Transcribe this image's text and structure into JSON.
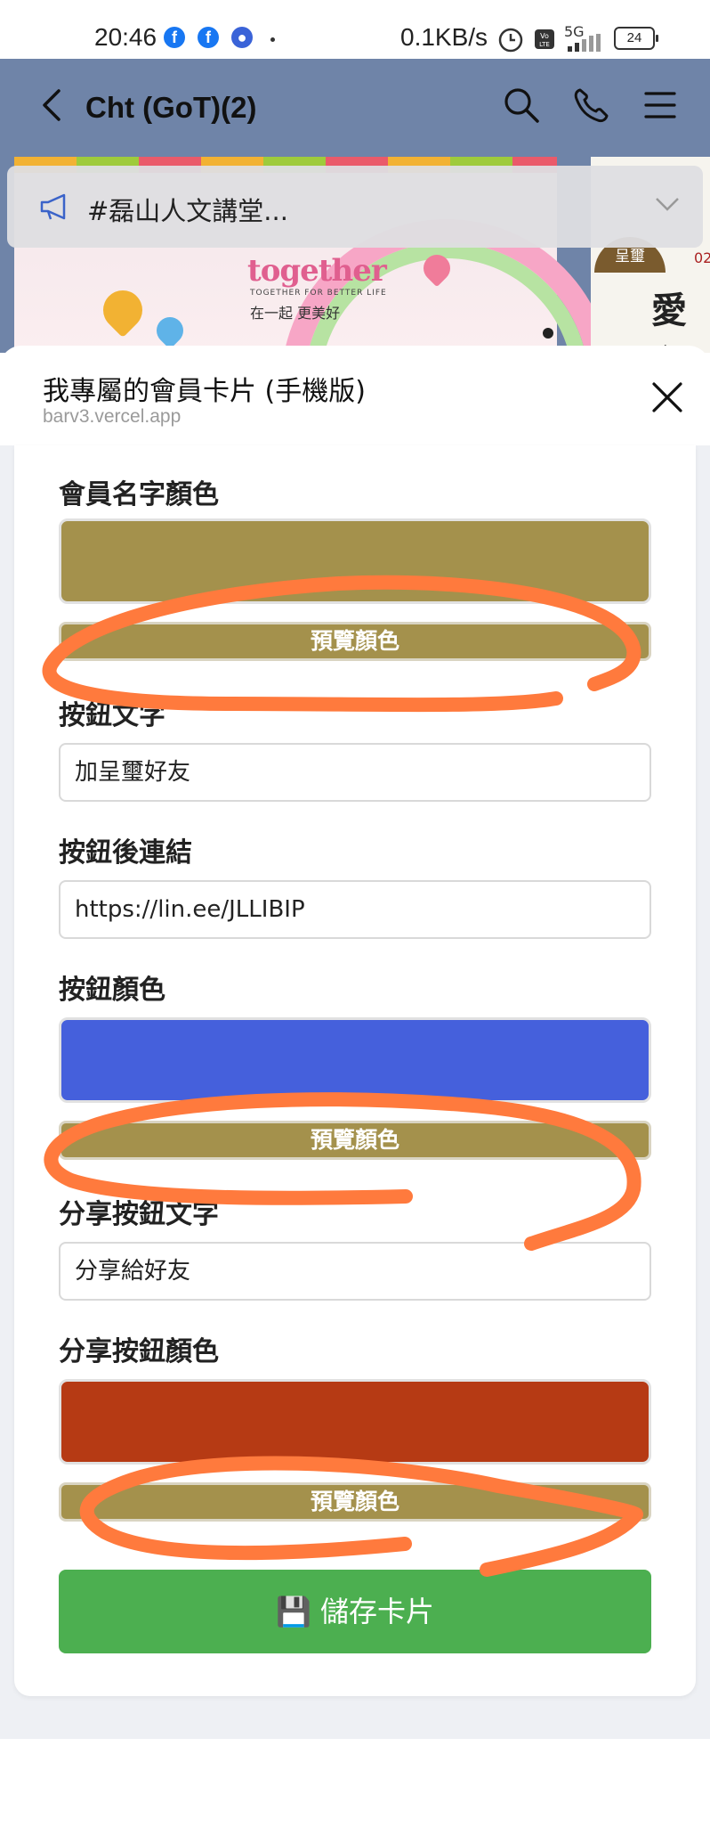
{
  "status_bar": {
    "time": "20:46",
    "speed": "0.1KB/s",
    "network": "5G",
    "battery": "24"
  },
  "chat_header": {
    "title": "Cht (GoT)(2)"
  },
  "announcement": {
    "text": "#磊山人文講堂..."
  },
  "chat_images": {
    "left_brand": "together",
    "left_brand_sub": "TOGETHER FOR BETTER LIFE",
    "left_slogan": "在一起 更美好",
    "right_badge": "呈璽",
    "right_number": "02",
    "right_big_text": "愛心"
  },
  "sheet": {
    "title": "我專屬的會員卡片 (手機版)",
    "url": "barv3.vercel.app"
  },
  "form": {
    "name_color_label": "會員名字顏色",
    "name_color_value": "#a4914c",
    "preview_label": "預覽顏色",
    "button_text_label": "按鈕文字",
    "button_text_value": "加呈璽好友",
    "button_link_label": "按鈕後連結",
    "button_link_value": "https://lin.ee/JLLIBIP",
    "button_color_label": "按鈕顏色",
    "button_color_value": "#4560dc",
    "share_text_label": "分享按鈕文字",
    "share_text_value": "分享給好友",
    "share_color_label": "分享按鈕顏色",
    "share_color_value": "#b63a14",
    "preview_color": "#a4914c",
    "save_icon": "💾",
    "save_label": "儲存卡片",
    "save_color": "#4caf50"
  },
  "annotation_color": "#ff7a3d"
}
